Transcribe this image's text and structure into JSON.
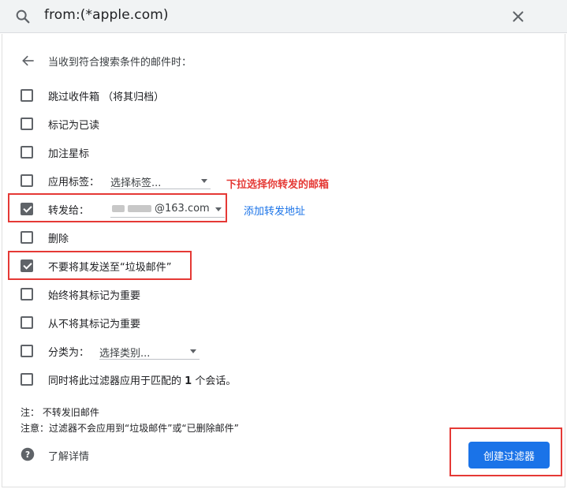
{
  "search": {
    "query": "from:(*apple.com)"
  },
  "heading": "当收到符合搜索条件的邮件时：",
  "options": [
    {
      "label": "跳过收件箱 （将其归档）",
      "checked": false
    },
    {
      "label": "标记为已读",
      "checked": false
    },
    {
      "label": "加注星标",
      "checked": false
    },
    {
      "label": "应用标签：",
      "checked": false
    },
    {
      "label": "转发给：",
      "checked": true
    },
    {
      "label": "删除",
      "checked": false
    },
    {
      "label": "不要将其发送至“垃圾邮件”",
      "checked": true
    },
    {
      "label": "始终将其标记为重要",
      "checked": false
    },
    {
      "label": "从不将其标记为重要",
      "checked": false
    },
    {
      "label": "分类为：",
      "checked": false
    },
    {
      "label_prefix": "同时将此过滤器应用于匹配的 ",
      "label_count": "1",
      "label_suffix": " 个会话。",
      "checked": false
    }
  ],
  "label_dropdown": "选择标签...",
  "forward_dropdown": "@163.com",
  "add_forward_link": "添加转发地址",
  "category_dropdown": "选择类别...",
  "annotation": "下拉选择你转发的邮箱",
  "notes": [
    "注：   不转发旧邮件",
    "注意：过滤器不会应用到“垃圾邮件”或“已删除邮件”"
  ],
  "help_link": "了解详情",
  "create_button": "创建过滤器",
  "colors": {
    "accent": "#1a73e8",
    "annotation": "#e53935"
  }
}
